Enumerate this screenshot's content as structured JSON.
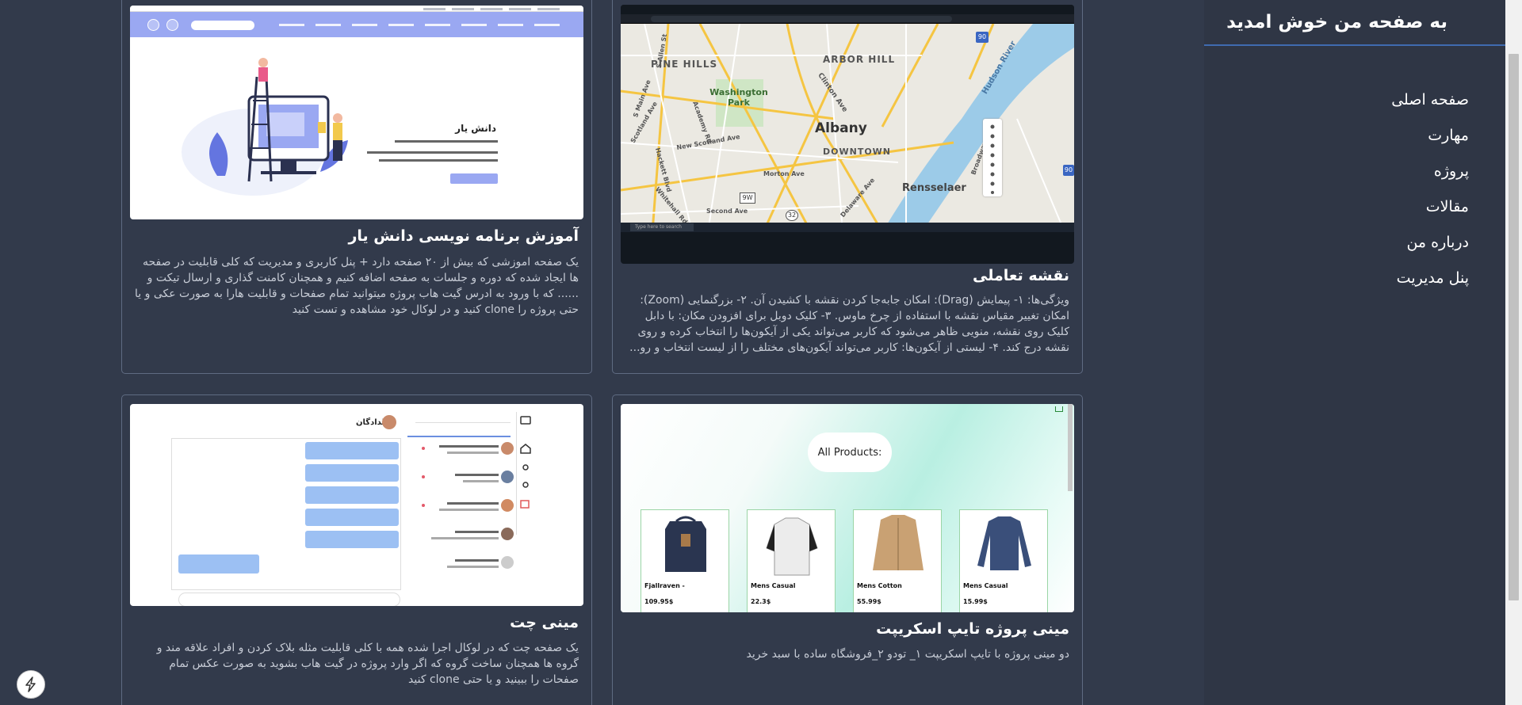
{
  "sidebar": {
    "title": "به صفحه من خوش امدید",
    "items": [
      {
        "label": "صفحه اصلی"
      },
      {
        "label": "مهارت"
      },
      {
        "label": "پروژه"
      },
      {
        "label": "مقالات"
      },
      {
        "label": "درباره من"
      },
      {
        "label": "پنل مدیریت"
      }
    ]
  },
  "cards": [
    {
      "title": "آموزش برنامه نویسی دانش یار",
      "description": "یک صفحه اموزشی که بیش از ۲۰ صفحه دارد + پنل کاربری و مدیریت که کلی قابلیت در صفحه ها ایجاد شده که دوره و جلسات به صفحه اضافه کنیم و همچنان کامنت گذاری و ارسال تیکت و ...... که با ورود به ادرس گیت هاب پروژه میتوانید تمام صفحات و قابلیت هارا به صورت عکی و یا حتی پروژه را clone کنید و در لوکال خود مشاهده و تست کنید",
      "thumb": {
        "hero_title": "دانش یار"
      }
    },
    {
      "title": "نقشه تعاملی",
      "description": "ویژگی‌ها: ۱- پیمایش (Drag): امکان جابه‌جا کردن نقشه با کشیدن آن. ۲- بزرگنمایی (Zoom): امکان تغییر مقیاس نقشه با استفاده از چرخ ماوس. ۳- کلیک دوبل برای افزودن مکان: با دابل کلیک روی نقشه، منویی ظاهر می‌شود که کاربر می‌تواند یکی از آیکون‌ها را انتخاب کرده و روی نقشه درج کند. ۴- لیستی از آیکون‌ها: کاربر می‌تواند آیکون‌های مختلف را از لیست انتخاب و رو...",
      "thumb": {
        "labels": [
          "PINE HILLS",
          "ARBOR HILL",
          "Washington Park",
          "Albany",
          "DOWNTOWN",
          "Rensselaer",
          "Clinton Ave",
          "Hudson River",
          "New Scotland Ave",
          "Second Ave",
          "Morton Ave",
          "Delaware Ave",
          "Academy Rd",
          "Hackett Blvd",
          "Whitehall Rd",
          "S Allen St",
          "S Main Ave",
          "Scotland Ave",
          "Broadway"
        ],
        "shields": [
          "90",
          "9W",
          "32",
          "90"
        ],
        "taskbar_search": "Type here to search"
      }
    },
    {
      "title": "مینی چت",
      "description": "یک صفحه چت که در لوکال اجرا شده همه با کلی قابلیت مثله بلاک کردن و افراد علاقه مند و گروه ها همچنان ساخت گروه که اگر وارد پروژه در گیت هاب بشوید به صورت عکس تمام صفحات را ببینید و یا حتی clone کنید",
      "thumb": {
        "header_name": "دلدادگان"
      }
    },
    {
      "title": "مینی پروژه تایپ اسکریپت",
      "description": "دو مینی پروژه با تایپ اسکریپت ۱_ تودو ۲_فروشگاه ساده با سبد خرید",
      "thumb": {
        "heading": "All Products:",
        "products": [
          {
            "name": "Fjallraven -",
            "price": "109.95$"
          },
          {
            "name": "Mens Casual",
            "price": "22.3$"
          },
          {
            "name": "Mens Cotton",
            "price": "55.99$"
          },
          {
            "name": "Mens Casual",
            "price": "15.99$"
          }
        ]
      }
    }
  ],
  "bolt_icon": "lightning-icon"
}
